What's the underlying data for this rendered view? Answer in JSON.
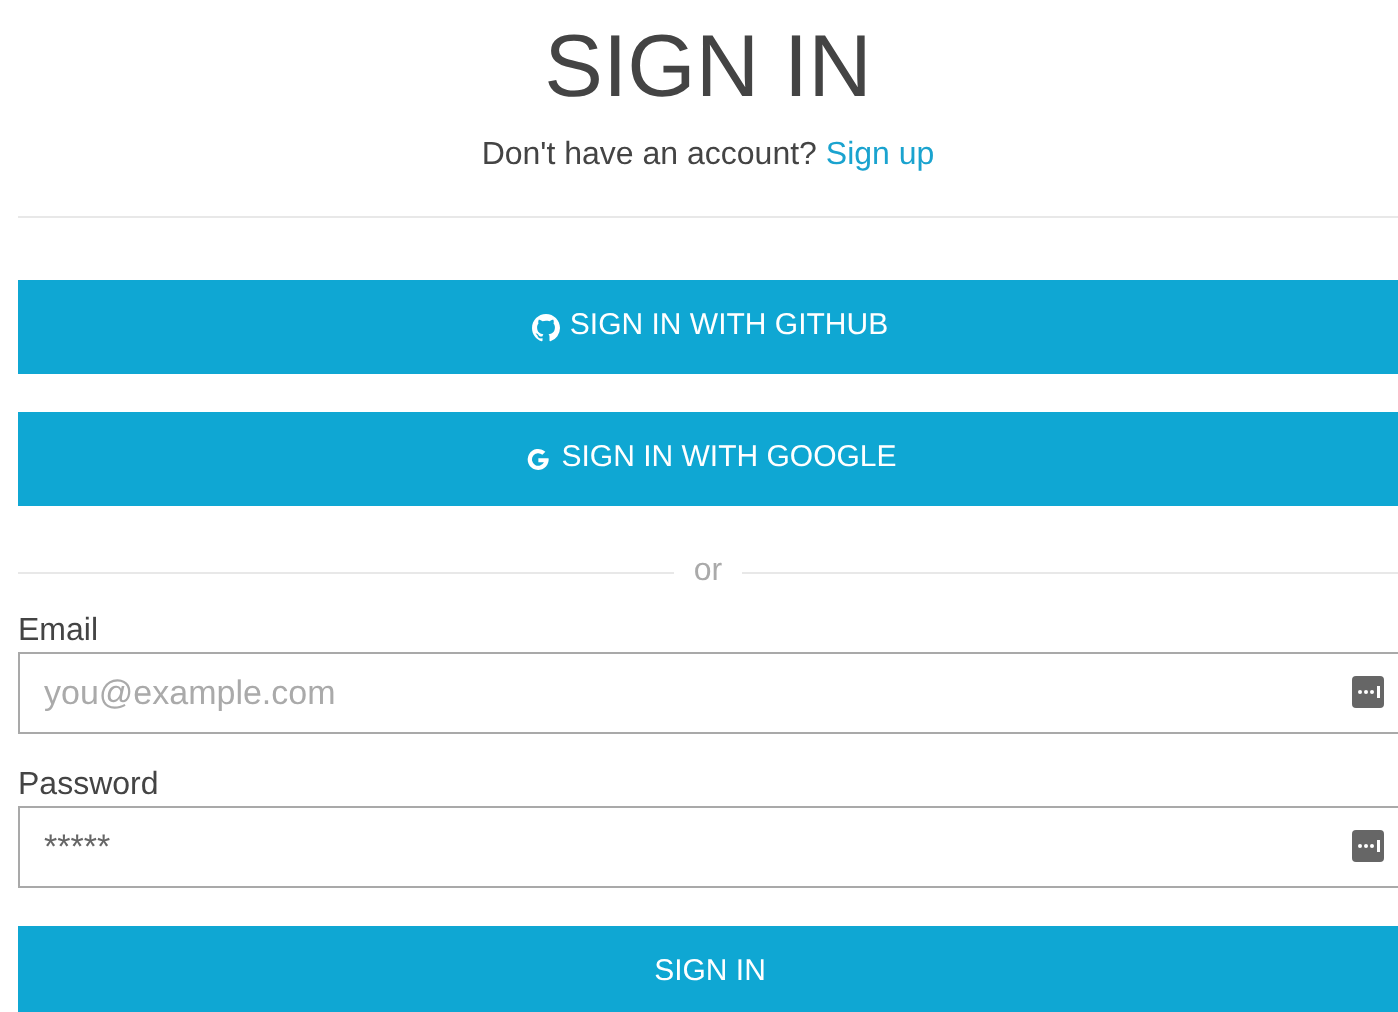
{
  "title": "SIGN IN",
  "signup_prompt": {
    "text": "Don't have an account?",
    "link": "Sign up"
  },
  "oauth_buttons": [
    {
      "kind": "github",
      "label": "SIGN IN WITH GITHUB"
    },
    {
      "kind": "google",
      "label": "SIGN IN WITH GOOGLE"
    }
  ],
  "separator": "or",
  "fields": [
    {
      "label": "Email",
      "placeholder": "you@example.com"
    },
    {
      "label": "Password",
      "value": "*****"
    }
  ],
  "submit": "SIGN IN"
}
